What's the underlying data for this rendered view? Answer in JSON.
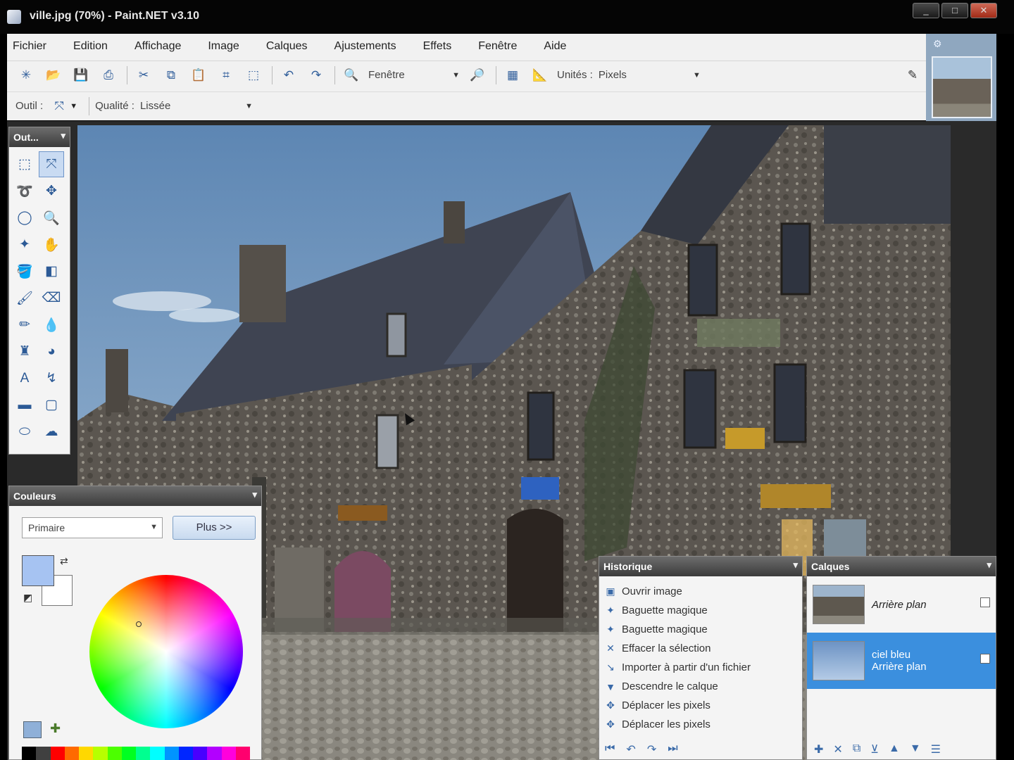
{
  "window": {
    "title": "ville.jpg (70%) - Paint.NET v3.10"
  },
  "window_controls": [
    "_",
    "□",
    "✕"
  ],
  "menu": [
    "Fichier",
    "Edition",
    "Affichage",
    "Image",
    "Calques",
    "Ajustements",
    "Effets",
    "Fenêtre",
    "Aide"
  ],
  "toolbar": {
    "zoom_label": "Fenêtre",
    "units_label": "Unités :",
    "units_value": "Pixels"
  },
  "tool_options": {
    "tool_label": "Outil :",
    "quality_label": "Qualité :",
    "quality_value": "Lissée"
  },
  "panels": {
    "tools_title": "Out...",
    "colors_title": "Couleurs",
    "history_title": "Historique",
    "layers_title": "Calques"
  },
  "colors": {
    "primary_select": "Primaire",
    "more_button": "Plus >>",
    "primary_color": "#a6c3f2",
    "secondary_color": "#ffffff",
    "palette": [
      "#000000",
      "#404040",
      "#ff0000",
      "#ff6a00",
      "#ffd800",
      "#b6ff00",
      "#4cff00",
      "#00ff21",
      "#00ff90",
      "#00ffff",
      "#0094ff",
      "#0026ff",
      "#4800ff",
      "#b200ff",
      "#ff00dc",
      "#ff006e"
    ]
  },
  "history": {
    "items": [
      {
        "icon": "open-image-icon",
        "glyph": "▣",
        "label": "Ouvrir image"
      },
      {
        "icon": "magic-wand-icon",
        "glyph": "✦",
        "label": "Baguette magique"
      },
      {
        "icon": "magic-wand-icon",
        "glyph": "✦",
        "label": "Baguette magique"
      },
      {
        "icon": "erase-selection-icon",
        "glyph": "✕",
        "label": "Effacer la sélection"
      },
      {
        "icon": "import-file-icon",
        "glyph": "↘",
        "label": "Importer à partir d'un fichier"
      },
      {
        "icon": "move-layer-down-icon",
        "glyph": "▼",
        "label": "Descendre le calque"
      },
      {
        "icon": "move-pixels-icon",
        "glyph": "✥",
        "label": "Déplacer les pixels"
      },
      {
        "icon": "move-pixels-icon",
        "glyph": "✥",
        "label": "Déplacer les pixels"
      }
    ]
  },
  "layers": {
    "items": [
      {
        "name": "Arrière plan",
        "selected": false
      },
      {
        "name": "ciel bleu\nArrière plan",
        "selected": true
      }
    ]
  }
}
